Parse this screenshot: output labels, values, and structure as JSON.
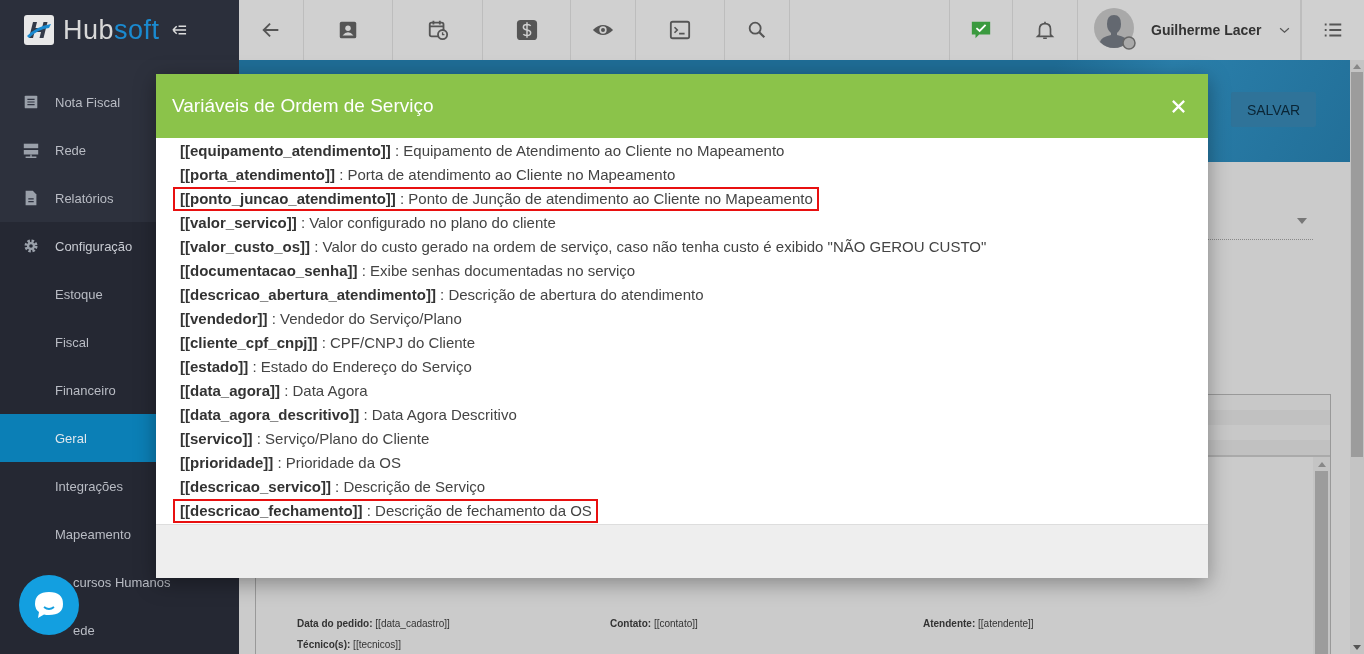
{
  "app": {
    "logo": [
      "Hub",
      "soft"
    ]
  },
  "sidebar": {
    "items": [
      {
        "label": "Nota Fiscal",
        "selected": false
      },
      {
        "label": "Rede",
        "selected": false
      },
      {
        "label": "Relatórios",
        "selected": false
      },
      {
        "label": "Configuração",
        "selected": false,
        "expanded": true,
        "children": [
          {
            "label": "Estoque",
            "selected": false
          },
          {
            "label": "Fiscal",
            "selected": false
          },
          {
            "label": "Financeiro",
            "selected": false
          },
          {
            "label": "Geral",
            "selected": true
          },
          {
            "label": "Integrações",
            "selected": false
          },
          {
            "label": "Mapeamento",
            "selected": false
          },
          {
            "label": "cursos Humanos",
            "selected": false
          },
          {
            "label": "ede",
            "selected": false
          }
        ]
      }
    ]
  },
  "topbar": {
    "user": {
      "name": "Guilherme Lacer"
    }
  },
  "page": {
    "save_button": "SALVAR",
    "fields": [
      {
        "label": "Data do pedido:",
        "value": "[[data_cadastro]]"
      },
      {
        "label": "Contato:",
        "value": "[[contato]]"
      },
      {
        "label": "Atendente:",
        "value": "[[atendente]]"
      },
      {
        "label": "Técnico(s):",
        "value": "[[tecnicos]]"
      }
    ]
  },
  "modal": {
    "title": "Variáveis de Ordem de Serviço",
    "items": [
      {
        "variable": "[[equipamento_atendimento]]",
        "description": ": Equipamento de Atendimento ao Cliente no Mapeamento",
        "highlighted": false
      },
      {
        "variable": "[[porta_atendimento]]",
        "description": ": Porta de atendimento ao Cliente no Mapeamento",
        "highlighted": false
      },
      {
        "variable": "[[ponto_juncao_atendimento]]",
        "description": ": Ponto de Junção de atendimento ao Cliente no Mapeamento",
        "highlighted": true
      },
      {
        "variable": "[[valor_servico]]",
        "description": ": Valor configurado no plano do cliente",
        "highlighted": false
      },
      {
        "variable": "[[valor_custo_os]]",
        "description": ": Valor do custo gerado na ordem de serviço, caso não tenha custo é exibido \"NÃO GEROU CUSTO\"",
        "highlighted": false
      },
      {
        "variable": "[[documentacao_senha]]",
        "description": ": Exibe senhas documentadas no serviço",
        "highlighted": false
      },
      {
        "variable": "[[descricao_abertura_atendimento]]",
        "description": ": Descrição de abertura do atendimento",
        "highlighted": false
      },
      {
        "variable": "[[vendedor]]",
        "description": ": Vendedor do Serviço/Plano",
        "highlighted": false
      },
      {
        "variable": "[[cliente_cpf_cnpj]]",
        "description": ": CPF/CNPJ do Cliente",
        "highlighted": false
      },
      {
        "variable": "[[estado]]",
        "description": ": Estado do Endereço do Serviço",
        "highlighted": false
      },
      {
        "variable": "[[data_agora]]",
        "description": ": Data Agora",
        "highlighted": false
      },
      {
        "variable": "[[data_agora_descritivo]]",
        "description": ": Data Agora Descritivo",
        "highlighted": false
      },
      {
        "variable": "[[servico]]",
        "description": ": Serviço/Plano do Cliente",
        "highlighted": false
      },
      {
        "variable": "[[prioridade]]",
        "description": ": Prioridade da OS",
        "highlighted": false
      },
      {
        "variable": "[[descricao_servico]]",
        "description": ": Descrição de Serviço",
        "highlighted": false
      },
      {
        "variable": "[[descricao_fechamento]]",
        "description": ": Descrição de fechamento da OS",
        "highlighted": true
      }
    ]
  }
}
